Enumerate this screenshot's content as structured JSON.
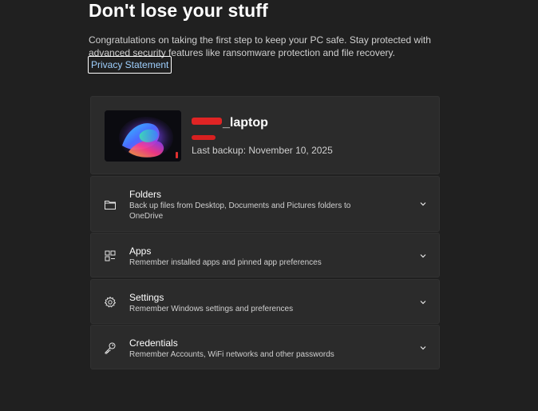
{
  "header": {
    "title": "Don't lose your stuff",
    "intro": "Congratulations on taking the first step to keep your PC safe. Stay protected with advanced security features like ransomware protection and file recovery.",
    "privacy_link": "Privacy Statement"
  },
  "device": {
    "name_suffix": "_laptop",
    "last_backup": "Last backup: November 10, 2025"
  },
  "sections": [
    {
      "title": "Folders",
      "description": "Back up files from Desktop, Documents and Pictures folders to OneDrive",
      "icon": "folder-icon"
    },
    {
      "title": "Apps",
      "description": "Remember installed apps and pinned app preferences",
      "icon": "apps-icon"
    },
    {
      "title": "Settings",
      "description": "Remember Windows settings and preferences",
      "icon": "gear-icon"
    },
    {
      "title": "Credentials",
      "description": "Remember Accounts, WiFi networks and other passwords",
      "icon": "key-icon"
    }
  ],
  "colors": {
    "background": "#202020",
    "card": "#2b2b2b",
    "link": "#9fd0ff",
    "redaction": "#e02424"
  }
}
